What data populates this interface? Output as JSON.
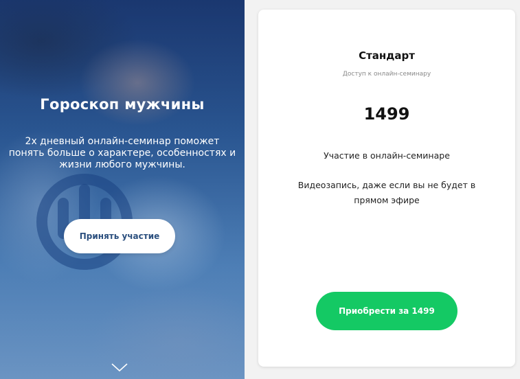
{
  "hero": {
    "title": "Гороскоп мужчины",
    "description": "2х дневный онлайн-семинар поможет понять больше о характере, особенностях и жизни любого мужчины.",
    "cta_label": "Принять участие",
    "logo_icon": "brand-logo-icon",
    "scroll_icon": "chevron-down-icon"
  },
  "card": {
    "title": "Стандарт",
    "subtitle": "Доступ к онлайн-семинару",
    "price": "1499",
    "features": [
      "Участие в онлайн-семинаре",
      "Видеозапись, даже если вы не будет в прямом эфире"
    ],
    "buy_label": "Приобрести за 1499"
  },
  "colors": {
    "accent_green": "#14c964",
    "hero_button_text": "#2b4f7e",
    "hero_overlay": "#2e5a92"
  }
}
